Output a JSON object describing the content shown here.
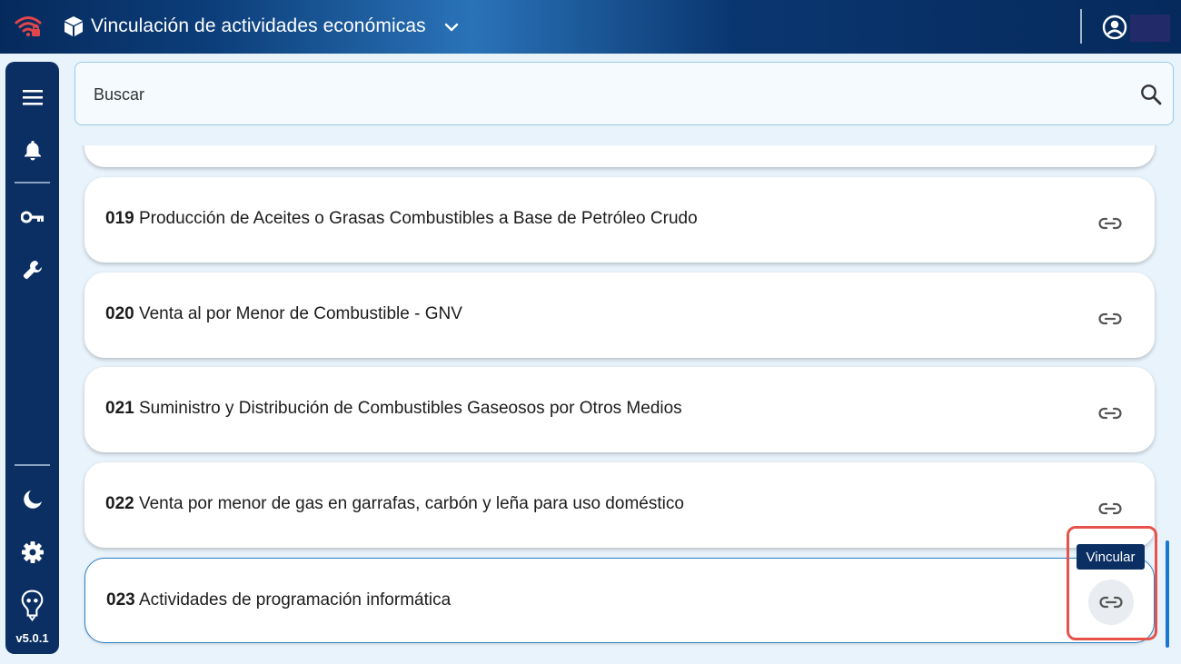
{
  "header": {
    "title": "Vinculación de actividades económicas"
  },
  "sidebar": {
    "version": "v5.0.1"
  },
  "search": {
    "placeholder": "Buscar"
  },
  "items": [
    {
      "code": "019",
      "name": "Producción de Aceites o Grasas Combustibles a Base de Petróleo Crudo"
    },
    {
      "code": "020",
      "name": "Venta al por Menor de Combustible - GNV"
    },
    {
      "code": "021",
      "name": "Suministro y Distribución de Combustibles Gaseosos por Otros Medios"
    },
    {
      "code": "022",
      "name": "Venta por menor de gas en garrafas, carbón y leña para uso doméstico"
    },
    {
      "code": "023",
      "name": "Actividades de programación informática"
    }
  ],
  "tooltip": {
    "text": "Vincular"
  },
  "colors": {
    "topbar": "#0c3e7a",
    "sidebar": "#0b2f63",
    "accent": "#1976d2",
    "highlight": "#e5534b"
  }
}
